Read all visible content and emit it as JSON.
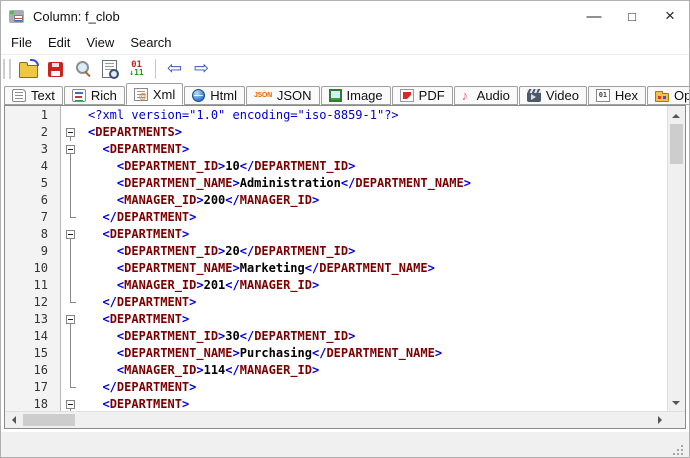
{
  "window": {
    "title": "Column: f_clob",
    "controls": {
      "minimize": "—",
      "maximize": "□",
      "close": "×"
    }
  },
  "menu": {
    "items": [
      "File",
      "Edit",
      "View",
      "Search"
    ]
  },
  "toolbar": {
    "buttons": [
      {
        "name": "open-file",
        "icon": "folder-open"
      },
      {
        "name": "save",
        "icon": "floppy-disk"
      },
      {
        "name": "zoom",
        "icon": "magnifier"
      },
      {
        "name": "print-preview",
        "icon": "document-magnifier"
      },
      {
        "name": "goto-position",
        "icon": "digits-01",
        "top": "01",
        "bottom": "↓11"
      },
      {
        "type": "separator"
      },
      {
        "name": "back",
        "icon": "arrow-left",
        "glyph": "⇦"
      },
      {
        "name": "forward",
        "icon": "arrow-right",
        "glyph": "⇨"
      }
    ]
  },
  "tabs": {
    "active": "Xml",
    "items": [
      {
        "label": "Text",
        "icon": "text-document"
      },
      {
        "label": "Rich",
        "icon": "rich-text"
      },
      {
        "label": "Xml",
        "icon": "xml-document"
      },
      {
        "label": "Html",
        "icon": "globe"
      },
      {
        "label": "JSON",
        "icon": "json-text",
        "icon_text": "JSON"
      },
      {
        "label": "Image",
        "icon": "picture"
      },
      {
        "label": "PDF",
        "icon": "pdf-document"
      },
      {
        "label": "Audio",
        "icon": "music-note",
        "icon_text": "♪"
      },
      {
        "label": "Video",
        "icon": "film-clapper"
      },
      {
        "label": "Hex",
        "icon": "binary-grid",
        "icon_text": "01"
      },
      {
        "label": "Open With",
        "icon": "folder-apps"
      }
    ]
  },
  "colors": {
    "declaration": "#0000cd",
    "bracket": "#0000e0",
    "tag": "#7d0000",
    "value": "#000000",
    "gutter_bg": "#f3f3f3"
  },
  "editor": {
    "lines": [
      {
        "n": 1,
        "fold": "",
        "seg": [
          [
            "d",
            "<?xml version=\"1.0\" encoding=\"iso-8859-1\"?>"
          ]
        ]
      },
      {
        "n": 2,
        "fold": "box",
        "seg": [
          [
            "b",
            "<"
          ],
          [
            "t",
            "DEPARTMENTS"
          ],
          [
            "b",
            ">"
          ]
        ]
      },
      {
        "n": 3,
        "fold": "box",
        "seg": [
          [
            "b",
            "  <"
          ],
          [
            "t",
            "DEPARTMENT"
          ],
          [
            "b",
            ">"
          ]
        ]
      },
      {
        "n": 4,
        "fold": "line",
        "seg": [
          [
            "b",
            "    <"
          ],
          [
            "t",
            "DEPARTMENT_ID"
          ],
          [
            "b",
            ">"
          ],
          [
            "v",
            "10"
          ],
          [
            "b",
            "</"
          ],
          [
            "t",
            "DEPARTMENT_ID"
          ],
          [
            "b",
            ">"
          ]
        ]
      },
      {
        "n": 5,
        "fold": "line",
        "seg": [
          [
            "b",
            "    <"
          ],
          [
            "t",
            "DEPARTMENT_NAME"
          ],
          [
            "b",
            ">"
          ],
          [
            "v",
            "Administration"
          ],
          [
            "b",
            "</"
          ],
          [
            "t",
            "DEPARTMENT_NAME"
          ],
          [
            "b",
            ">"
          ]
        ]
      },
      {
        "n": 6,
        "fold": "line",
        "seg": [
          [
            "b",
            "    <"
          ],
          [
            "t",
            "MANAGER_ID"
          ],
          [
            "b",
            ">"
          ],
          [
            "v",
            "200"
          ],
          [
            "b",
            "</"
          ],
          [
            "t",
            "MANAGER_ID"
          ],
          [
            "b",
            ">"
          ]
        ]
      },
      {
        "n": 7,
        "fold": "end",
        "seg": [
          [
            "b",
            "  </"
          ],
          [
            "t",
            "DEPARTMENT"
          ],
          [
            "b",
            ">"
          ]
        ]
      },
      {
        "n": 8,
        "fold": "box",
        "seg": [
          [
            "b",
            "  <"
          ],
          [
            "t",
            "DEPARTMENT"
          ],
          [
            "b",
            ">"
          ]
        ]
      },
      {
        "n": 9,
        "fold": "line",
        "seg": [
          [
            "b",
            "    <"
          ],
          [
            "t",
            "DEPARTMENT_ID"
          ],
          [
            "b",
            ">"
          ],
          [
            "v",
            "20"
          ],
          [
            "b",
            "</"
          ],
          [
            "t",
            "DEPARTMENT_ID"
          ],
          [
            "b",
            ">"
          ]
        ]
      },
      {
        "n": 10,
        "fold": "line",
        "seg": [
          [
            "b",
            "    <"
          ],
          [
            "t",
            "DEPARTMENT_NAME"
          ],
          [
            "b",
            ">"
          ],
          [
            "v",
            "Marketing"
          ],
          [
            "b",
            "</"
          ],
          [
            "t",
            "DEPARTMENT_NAME"
          ],
          [
            "b",
            ">"
          ]
        ]
      },
      {
        "n": 11,
        "fold": "line",
        "seg": [
          [
            "b",
            "    <"
          ],
          [
            "t",
            "MANAGER_ID"
          ],
          [
            "b",
            ">"
          ],
          [
            "v",
            "201"
          ],
          [
            "b",
            "</"
          ],
          [
            "t",
            "MANAGER_ID"
          ],
          [
            "b",
            ">"
          ]
        ]
      },
      {
        "n": 12,
        "fold": "end",
        "seg": [
          [
            "b",
            "  </"
          ],
          [
            "t",
            "DEPARTMENT"
          ],
          [
            "b",
            ">"
          ]
        ]
      },
      {
        "n": 13,
        "fold": "box",
        "seg": [
          [
            "b",
            "  <"
          ],
          [
            "t",
            "DEPARTMENT"
          ],
          [
            "b",
            ">"
          ]
        ]
      },
      {
        "n": 14,
        "fold": "line",
        "seg": [
          [
            "b",
            "    <"
          ],
          [
            "t",
            "DEPARTMENT_ID"
          ],
          [
            "b",
            ">"
          ],
          [
            "v",
            "30"
          ],
          [
            "b",
            "</"
          ],
          [
            "t",
            "DEPARTMENT_ID"
          ],
          [
            "b",
            ">"
          ]
        ]
      },
      {
        "n": 15,
        "fold": "line",
        "seg": [
          [
            "b",
            "    <"
          ],
          [
            "t",
            "DEPARTMENT_NAME"
          ],
          [
            "b",
            ">"
          ],
          [
            "v",
            "Purchasing"
          ],
          [
            "b",
            "</"
          ],
          [
            "t",
            "DEPARTMENT_NAME"
          ],
          [
            "b",
            ">"
          ]
        ]
      },
      {
        "n": 16,
        "fold": "line",
        "seg": [
          [
            "b",
            "    <"
          ],
          [
            "t",
            "MANAGER_ID"
          ],
          [
            "b",
            ">"
          ],
          [
            "v",
            "114"
          ],
          [
            "b",
            "</"
          ],
          [
            "t",
            "MANAGER_ID"
          ],
          [
            "b",
            ">"
          ]
        ]
      },
      {
        "n": 17,
        "fold": "end",
        "seg": [
          [
            "b",
            "  </"
          ],
          [
            "t",
            "DEPARTMENT"
          ],
          [
            "b",
            ">"
          ]
        ]
      },
      {
        "n": 18,
        "fold": "box",
        "seg": [
          [
            "b",
            "  <"
          ],
          [
            "t",
            "DEPARTMENT"
          ],
          [
            "b",
            ">"
          ]
        ]
      }
    ]
  }
}
